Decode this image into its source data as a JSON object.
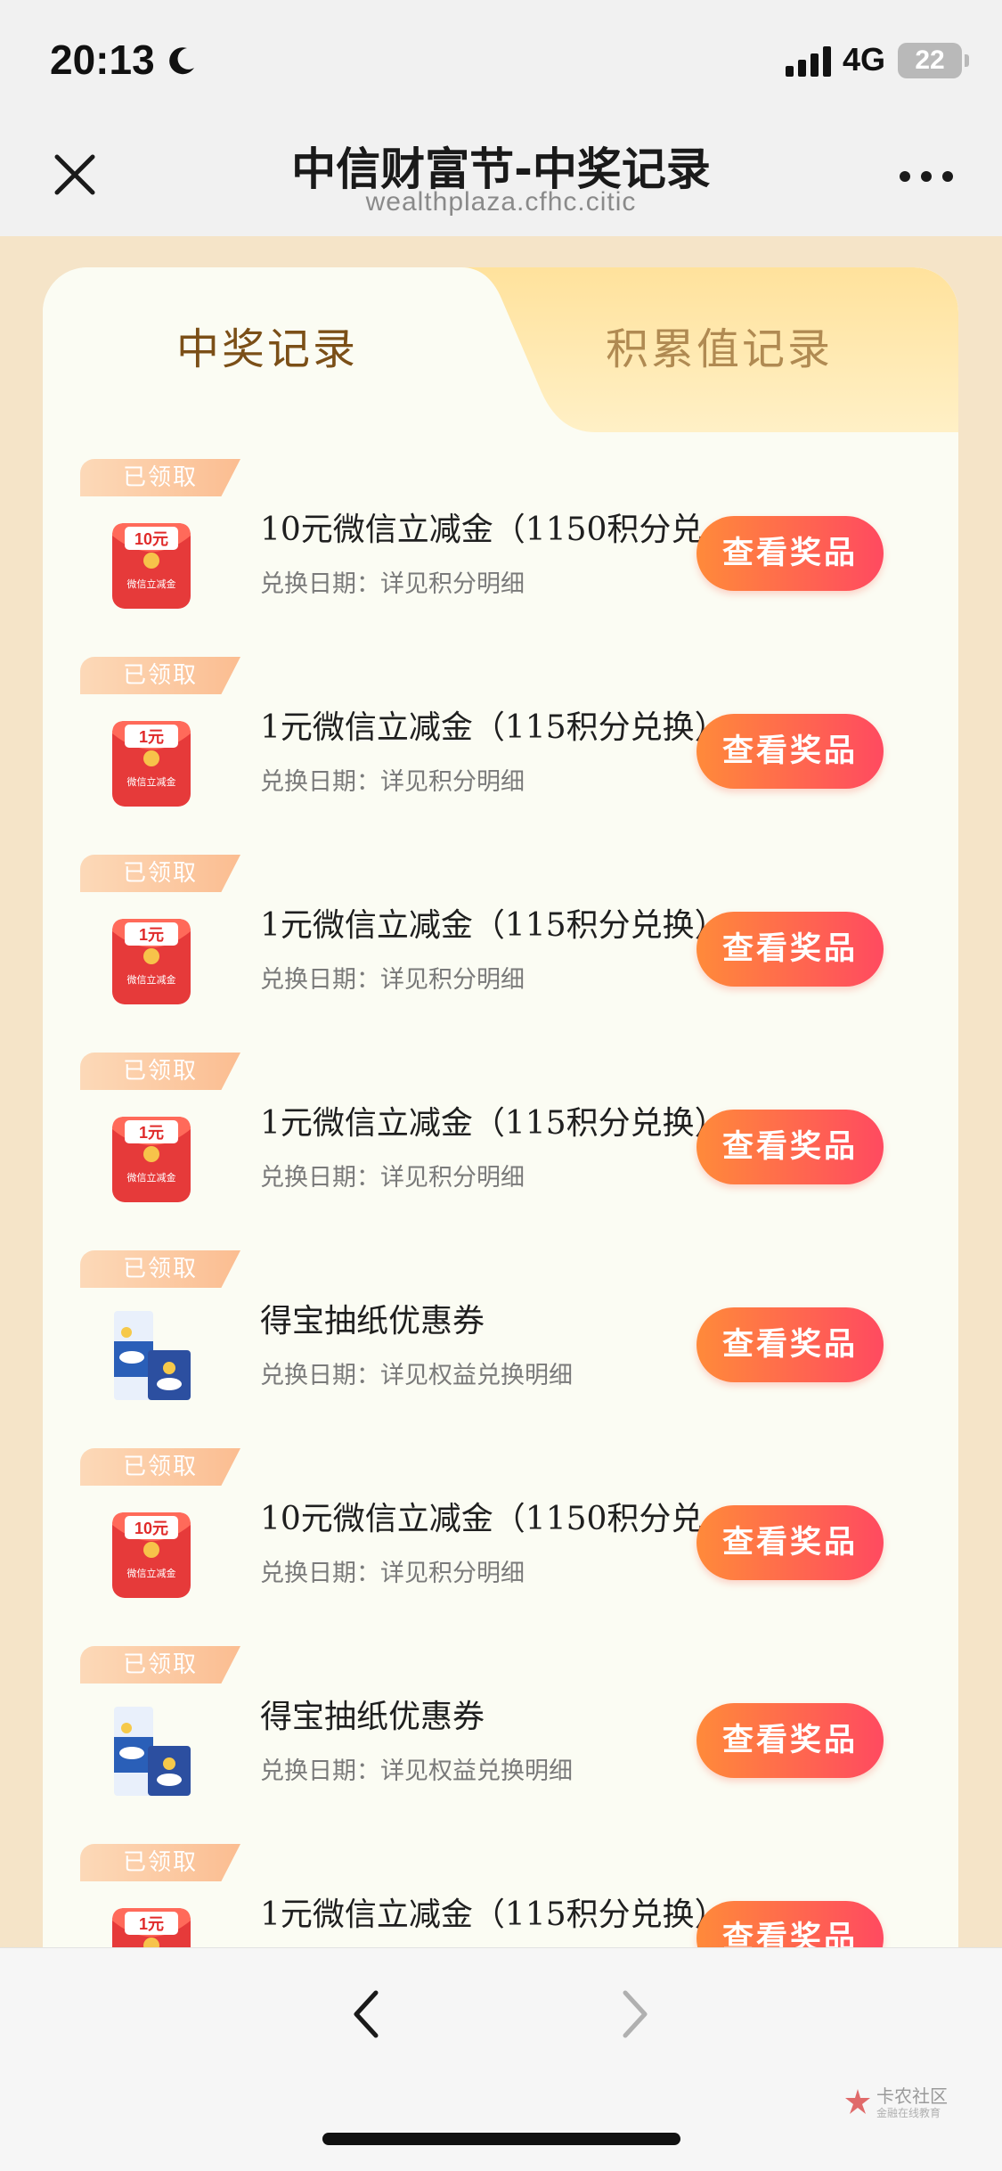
{
  "status_bar": {
    "time": "20:13",
    "network": "4G",
    "battery": "22"
  },
  "nav": {
    "title": "中信财富节-中奖记录",
    "url": "wealthplaza.cfhc.citic"
  },
  "tabs": [
    {
      "label": "中奖记录",
      "active": true
    },
    {
      "label": "积累值记录",
      "active": false
    }
  ],
  "records": [
    {
      "badge": "已领取",
      "prize_image": "red-envelope-10-yuan",
      "image_label_amount": "10元",
      "image_label_text": "微信立减金",
      "title": "10元微信立减金（1150积分兑换）",
      "date": "兑换日期：详见积分明细",
      "button": "查看奖品"
    },
    {
      "badge": "已领取",
      "prize_image": "red-envelope-1-yuan",
      "image_label_amount": "1元",
      "image_label_text": "微信立减金",
      "title": "1元微信立减金（115积分兑换）",
      "date": "兑换日期：详见积分明细",
      "button": "查看奖品"
    },
    {
      "badge": "已领取",
      "prize_image": "red-envelope-1-yuan",
      "image_label_amount": "1元",
      "image_label_text": "微信立减金",
      "title": "1元微信立减金（115积分兑换）",
      "date": "兑换日期：详见积分明细",
      "button": "查看奖品"
    },
    {
      "badge": "已领取",
      "prize_image": "red-envelope-1-yuan",
      "image_label_amount": "1元",
      "image_label_text": "微信立减金",
      "title": "1元微信立减金（115积分兑换）",
      "date": "兑换日期：详见积分明细",
      "button": "查看奖品"
    },
    {
      "badge": "已领取",
      "prize_image": "tissue-pack",
      "image_label_amount": "",
      "image_label_text": "",
      "title": "得宝抽纸优惠券",
      "date": "兑换日期：详见权益兑换明细",
      "button": "查看奖品"
    },
    {
      "badge": "已领取",
      "prize_image": "red-envelope-10-yuan",
      "image_label_amount": "10元",
      "image_label_text": "微信立减金",
      "title": "10元微信立减金（1150积分兑换）",
      "date": "兑换日期：详见积分明细",
      "button": "查看奖品"
    },
    {
      "badge": "已领取",
      "prize_image": "tissue-pack",
      "image_label_amount": "",
      "image_label_text": "",
      "title": "得宝抽纸优惠券",
      "date": "兑换日期：详见权益兑换明细",
      "button": "查看奖品"
    },
    {
      "badge": "已领取",
      "prize_image": "red-envelope-1-yuan",
      "image_label_amount": "1元",
      "image_label_text": "微信立减金",
      "title": "1元微信立减金（115积分兑换）",
      "date": "",
      "button": "查看奖品"
    }
  ],
  "watermark": {
    "text": "卡农社区",
    "sub": "金融在线教育"
  },
  "colors": {
    "button_gradient_start": "#ff8a3a",
    "button_gradient_end": "#ff4a60",
    "card_bg": "#fbfcf3",
    "page_bg": "#f5e4c8",
    "active_tab_text": "#7b4f17"
  }
}
